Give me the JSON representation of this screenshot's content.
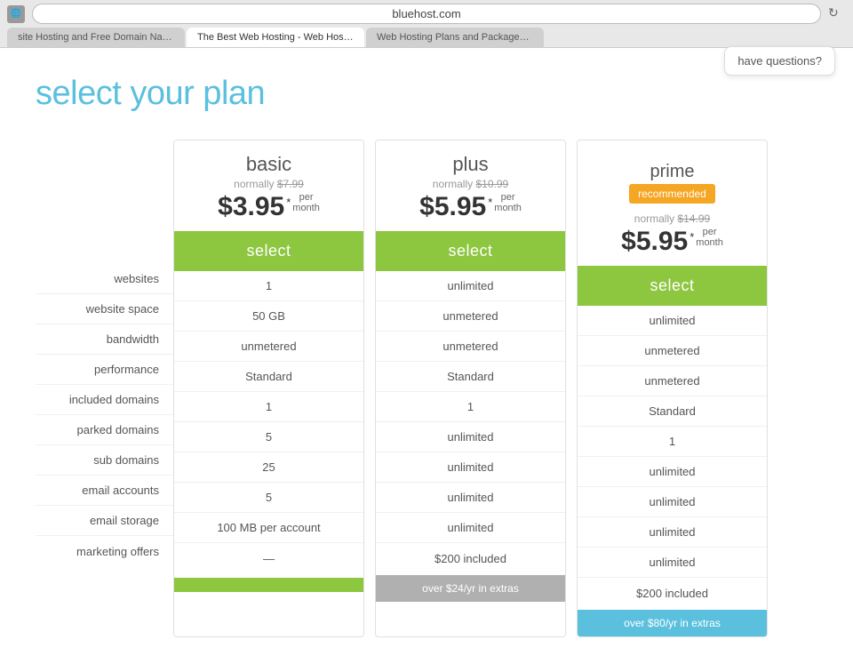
{
  "browser": {
    "icon": "🌐",
    "address": "bluehost.com",
    "tabs": [
      {
        "label": "site Hosting and Free Domain Name",
        "active": false
      },
      {
        "label": "The Best Web Hosting - Web Hosting Services - Bluehost",
        "active": true
      },
      {
        "label": "Web Hosting Plans and Packages - Web Hosti...",
        "active": false
      }
    ],
    "help_text": "have questions?"
  },
  "page": {
    "title": "select your plan"
  },
  "features": [
    "websites",
    "website space",
    "bandwidth",
    "performance",
    "included domains",
    "parked domains",
    "sub domains",
    "email accounts",
    "email storage",
    "marketing offers"
  ],
  "plans": [
    {
      "name": "basic",
      "recommended": false,
      "normal_price": "$7.99",
      "price": "$3.95",
      "per_month": "per month",
      "select_label": "select",
      "values": [
        "1",
        "50 GB",
        "unmetered",
        "Standard",
        "1",
        "5",
        "25",
        "5",
        "100 MB per account",
        "—"
      ],
      "extras_label": "",
      "extras_type": "green"
    },
    {
      "name": "plus",
      "recommended": false,
      "normal_price": "$10.99",
      "price": "$5.95",
      "per_month": "per month",
      "select_label": "select",
      "values": [
        "unlimited",
        "unmetered",
        "unmetered",
        "Standard",
        "1",
        "unlimited",
        "unlimited",
        "unlimited",
        "unlimited",
        "$200 included"
      ],
      "extras_label": "over $24/yr in extras",
      "extras_type": "gray"
    },
    {
      "name": "prime",
      "recommended": true,
      "recommended_label": "recommended",
      "normal_price": "$14.99",
      "price": "$5.95",
      "per_month": "per month",
      "select_label": "select",
      "values": [
        "unlimited",
        "unmetered",
        "unmetered",
        "Standard",
        "1",
        "unlimited",
        "unlimited",
        "unlimited",
        "unlimited",
        "$200 included"
      ],
      "extras_label": "over $80/yr in extras",
      "extras_type": "blue"
    }
  ]
}
